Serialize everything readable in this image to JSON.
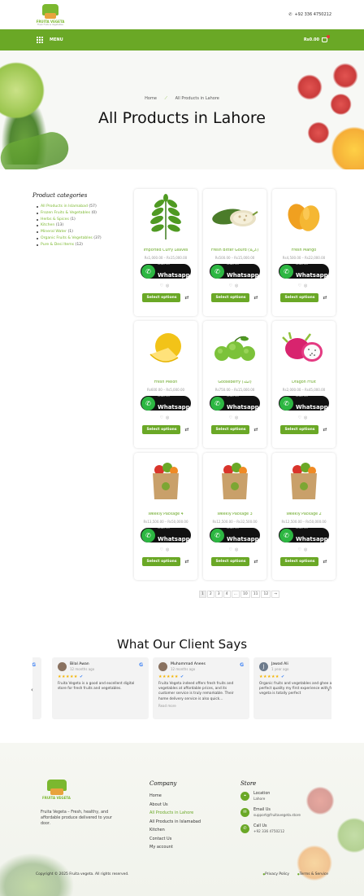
{
  "header": {
    "logo_text": "FRUITA VEGETA",
    "logo_tagline": "Fresh Fruits & Vegetables",
    "phone": "+92 336 4750212"
  },
  "nav": {
    "menu_label": "MENU",
    "cart_total": "Rs0.00",
    "cart_count": "0"
  },
  "hero": {
    "breadcrumb_home": "Home",
    "breadcrumb_current": "All Products in Lahore",
    "title": "All Products in Lahore"
  },
  "sidebar": {
    "title": "Product categories",
    "items": [
      {
        "label": "All Products in Islamabad",
        "count": "(57)"
      },
      {
        "label": "Frozen Fruits & Vegetables",
        "count": "(0)"
      },
      {
        "label": "Herbs & Spices",
        "count": "(1)"
      },
      {
        "label": "Kitchen",
        "count": "(13)"
      },
      {
        "label": "Mineral Water",
        "count": "(1)"
      },
      {
        "label": "Organic Fruits & Vegetables",
        "count": "(37)"
      },
      {
        "label": "Pure & Desi Items",
        "count": "(12)"
      }
    ]
  },
  "whatsapp": {
    "small": "Order On",
    "big": "Whatsapp"
  },
  "select_label": "Select options",
  "products": [
    {
      "name": "Imported Curry Leaves",
      "price": "Rs1,000.00 – Rs15,000.00"
    },
    {
      "name": "Fresh Bitter Gourd (کریلا)",
      "price": "Rs500.00 – Rs15,000.00"
    },
    {
      "name": "Fresh Mango",
      "price": "Rs4,500.00 – Rs22,000.00"
    },
    {
      "name": "Fresh Melon",
      "price": "Rs600.00 – Rs5,000.00"
    },
    {
      "name": "Gooseberry (آملہ)",
      "price": "Rs750.00 – Rs15,000.00"
    },
    {
      "name": "Dragon Fruit",
      "price": "Rs2,000.00 – Rs45,000.00"
    },
    {
      "name": "Weekly Package 4",
      "price": "Rs13,500.00 – Rs50,000.00"
    },
    {
      "name": "Weekly Package 3",
      "price": "Rs12,500.00 – Rs32,500.00"
    },
    {
      "name": "Weekly Package 2",
      "price": "Rs12,500.00 – Rs50,000.00"
    }
  ],
  "pagination": [
    "1",
    "2",
    "3",
    "4",
    "…",
    "10",
    "11",
    "12",
    "→"
  ],
  "testimonials": {
    "title": "What Our Client Says",
    "items": [
      {
        "name": "Bilal Awan",
        "time": "12 months ago",
        "text": "Fruita Vegeta is a good and excellent digital store for fresh fruits and vegetables.",
        "more": ""
      },
      {
        "name": "Muhammad Anees",
        "time": "12 months ago",
        "text": "Fruita Vegeta indeed offers fresh fruits and vegetables at affordable prices, and its customer service is truly remarkable. Their home delivery service is also quick…",
        "more": "Read more"
      },
      {
        "name": "Jawad Ali",
        "time": "1 year ago",
        "text": "Organic fruits and vegetables and ghee also perfect quality my first experience with fruits vegeta is totally perfect",
        "more": ""
      }
    ],
    "stars": "★★★★★",
    "google": "G"
  },
  "footer": {
    "logo_text": "FRUITA VEGETA",
    "desc": "Fruita Vegeta – Fresh, healthy, and affordable produce delivered to your door.",
    "company_title": "Company",
    "company_links": [
      "Home",
      "About Us",
      "All Products in Lahore",
      "All Products in Islamabad",
      "Kitchen",
      "Contact Us",
      "My account"
    ],
    "store_title": "Store",
    "location_label": "Location",
    "location_value": "Lahore",
    "email_label": "Email Us",
    "email_value": "support@fruitavegeta.store",
    "call_label": "Call Us",
    "call_value": "+92 336 4750212",
    "copyright": "Copyright © 2025 Fruita vegeta. All rights reserved.",
    "privacy": "Privacy Policy",
    "terms": "Terms & Service"
  },
  "colors": {
    "brand": "#6aa826",
    "star": "#f4b400",
    "whatsapp": "#2db742"
  }
}
